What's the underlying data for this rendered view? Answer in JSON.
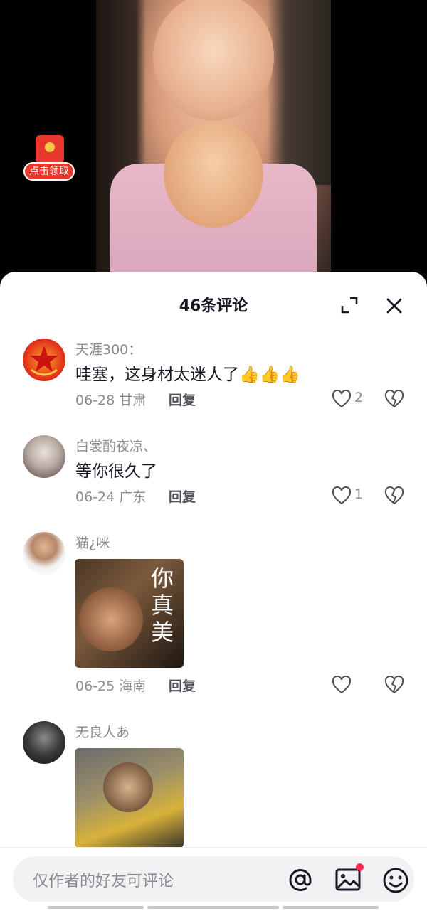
{
  "video": {
    "overlay_badge_label": "点击领取"
  },
  "comments_panel": {
    "title": "46条评论",
    "reply_label": "回复",
    "comments": [
      {
        "username": "天涯300：",
        "text": "哇塞，这身材太迷人了👍👍👍",
        "date_location": "06-28 甘肃",
        "like_count": "2"
      },
      {
        "username": "白裳酌夜凉、",
        "text": "等你很久了",
        "date_location": "06-24 广东",
        "like_count": "1"
      },
      {
        "username": "猫¿咪",
        "sticker_text": "你真美",
        "date_location": "06-25 海南",
        "like_count": ""
      },
      {
        "username": "无良人あ"
      }
    ]
  },
  "input_bar": {
    "placeholder": "仅作者的好友可评论",
    "image_badge_color": "#fe2c55"
  },
  "colors": {
    "accent": "#fe2c55",
    "red_packet": "#e8372d",
    "secondary_text": "#8a8b91"
  },
  "icons": [
    "red-packet-icon",
    "expand-icon",
    "close-icon",
    "heart-icon",
    "broken-heart-icon",
    "at-icon",
    "image-icon",
    "emoji-icon"
  ]
}
